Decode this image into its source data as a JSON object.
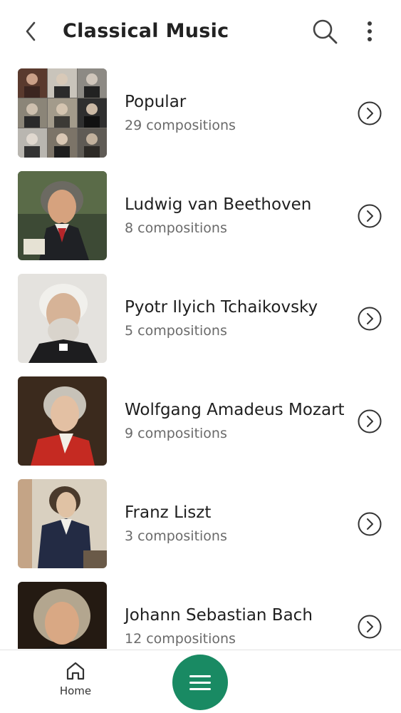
{
  "header": {
    "title": "Classical Music",
    "back_icon": "chevron-left-icon",
    "search_icon": "search-icon",
    "more_icon": "more-vertical-icon"
  },
  "list": {
    "items": [
      {
        "title": "Popular",
        "subtitle": "29 compositions",
        "image": "composer-collage"
      },
      {
        "title": "Ludwig van Beethoven",
        "subtitle": "8 compositions",
        "image": "beethoven-portrait"
      },
      {
        "title": "Pyotr Ilyich Tchaikovsky",
        "subtitle": "5 compositions",
        "image": "tchaikovsky-portrait"
      },
      {
        "title": "Wolfgang Amadeus Mozart",
        "subtitle": "9 compositions",
        "image": "mozart-portrait"
      },
      {
        "title": "Franz Liszt",
        "subtitle": "3 compositions",
        "image": "liszt-portrait"
      },
      {
        "title": "Johann Sebastian Bach",
        "subtitle": "12 compositions",
        "image": "bach-portrait"
      }
    ]
  },
  "bottom_nav": {
    "home_label": "Home",
    "menu_icon": "menu-icon",
    "accent_color": "#198a63"
  }
}
